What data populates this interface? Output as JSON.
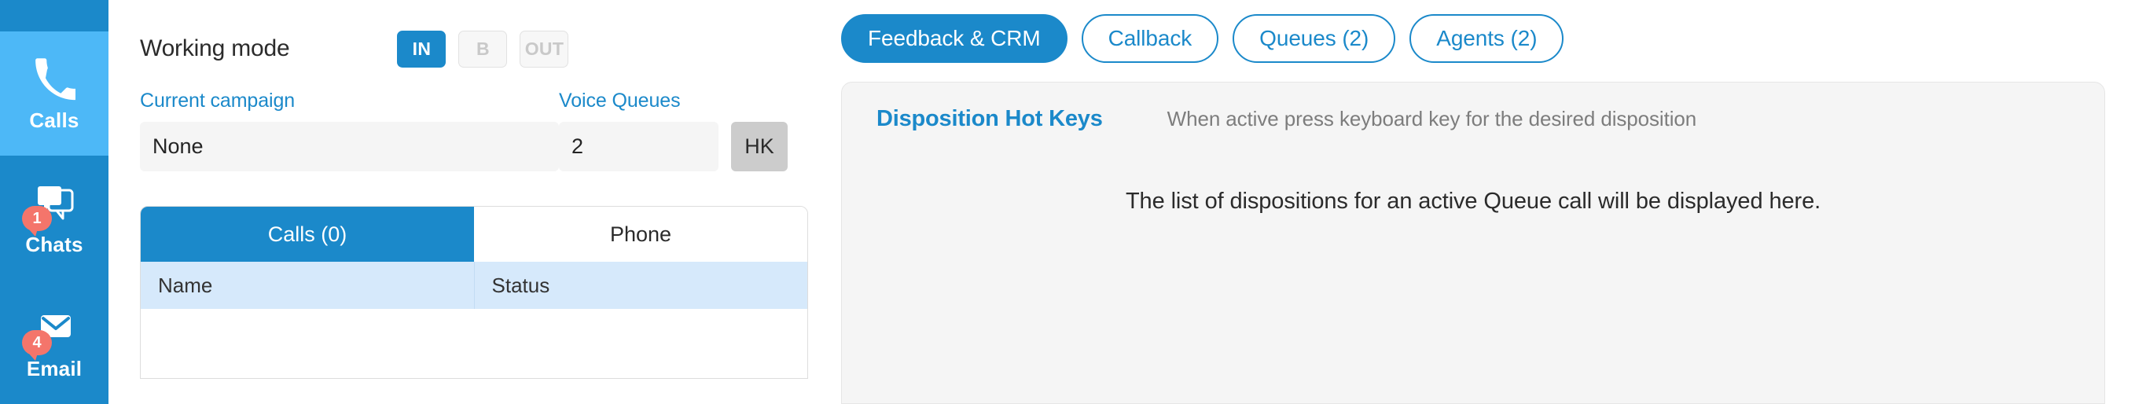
{
  "sidebar": {
    "items": [
      {
        "label": "Calls",
        "icon": "phone-icon",
        "badge": null,
        "active": true
      },
      {
        "label": "Chats",
        "icon": "chat-icon",
        "badge": "1",
        "active": false
      },
      {
        "label": "Email",
        "icon": "envelope-icon",
        "badge": "4",
        "active": false
      }
    ]
  },
  "left": {
    "working_mode_title": "Working mode",
    "modes": [
      {
        "label": "IN",
        "selected": true
      },
      {
        "label": "B",
        "selected": false
      },
      {
        "label": "OUT",
        "selected": false
      }
    ],
    "campaign": {
      "label": "Current campaign",
      "value": "None"
    },
    "queues": {
      "label": "Voice Queues",
      "value": "2"
    },
    "hotkeys_button": "HK",
    "tabs": [
      {
        "label": "Calls (0)",
        "active": true
      },
      {
        "label": "Phone",
        "active": false
      }
    ],
    "table": {
      "columns": [
        "Name",
        "Status"
      ],
      "rows": []
    }
  },
  "right": {
    "tabs": [
      {
        "label": "Feedback & CRM",
        "active": true
      },
      {
        "label": "Callback",
        "active": false
      },
      {
        "label": "Queues (2)",
        "active": false
      },
      {
        "label": "Agents (2)",
        "active": false
      }
    ],
    "card": {
      "title": "Disposition Hot Keys",
      "hint": "When active press keyboard key for the desired disposition",
      "empty_message": "The list of dispositions for an active Queue call will be displayed here."
    }
  },
  "colors": {
    "brand_blue": "#1B89CA",
    "active_blue": "#4DB8F7",
    "badge_red": "#F4756B",
    "panel_gray": "#F5F5F5",
    "table_header_blue": "#D6E9FB",
    "hk_gray": "#CCCCCC"
  }
}
